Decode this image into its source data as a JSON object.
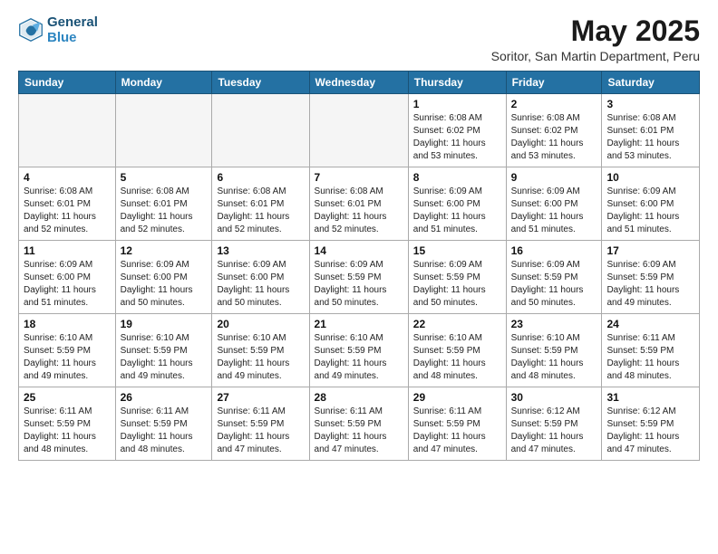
{
  "logo": {
    "line1": "General",
    "line2": "Blue"
  },
  "title": "May 2025",
  "subtitle": "Soritor, San Martin Department, Peru",
  "days_of_week": [
    "Sunday",
    "Monday",
    "Tuesday",
    "Wednesday",
    "Thursday",
    "Friday",
    "Saturday"
  ],
  "weeks": [
    [
      {
        "day": "",
        "info": ""
      },
      {
        "day": "",
        "info": ""
      },
      {
        "day": "",
        "info": ""
      },
      {
        "day": "",
        "info": ""
      },
      {
        "day": "1",
        "info": "Sunrise: 6:08 AM\nSunset: 6:02 PM\nDaylight: 11 hours\nand 53 minutes."
      },
      {
        "day": "2",
        "info": "Sunrise: 6:08 AM\nSunset: 6:02 PM\nDaylight: 11 hours\nand 53 minutes."
      },
      {
        "day": "3",
        "info": "Sunrise: 6:08 AM\nSunset: 6:01 PM\nDaylight: 11 hours\nand 53 minutes."
      }
    ],
    [
      {
        "day": "4",
        "info": "Sunrise: 6:08 AM\nSunset: 6:01 PM\nDaylight: 11 hours\nand 52 minutes."
      },
      {
        "day": "5",
        "info": "Sunrise: 6:08 AM\nSunset: 6:01 PM\nDaylight: 11 hours\nand 52 minutes."
      },
      {
        "day": "6",
        "info": "Sunrise: 6:08 AM\nSunset: 6:01 PM\nDaylight: 11 hours\nand 52 minutes."
      },
      {
        "day": "7",
        "info": "Sunrise: 6:08 AM\nSunset: 6:01 PM\nDaylight: 11 hours\nand 52 minutes."
      },
      {
        "day": "8",
        "info": "Sunrise: 6:09 AM\nSunset: 6:00 PM\nDaylight: 11 hours\nand 51 minutes."
      },
      {
        "day": "9",
        "info": "Sunrise: 6:09 AM\nSunset: 6:00 PM\nDaylight: 11 hours\nand 51 minutes."
      },
      {
        "day": "10",
        "info": "Sunrise: 6:09 AM\nSunset: 6:00 PM\nDaylight: 11 hours\nand 51 minutes."
      }
    ],
    [
      {
        "day": "11",
        "info": "Sunrise: 6:09 AM\nSunset: 6:00 PM\nDaylight: 11 hours\nand 51 minutes."
      },
      {
        "day": "12",
        "info": "Sunrise: 6:09 AM\nSunset: 6:00 PM\nDaylight: 11 hours\nand 50 minutes."
      },
      {
        "day": "13",
        "info": "Sunrise: 6:09 AM\nSunset: 6:00 PM\nDaylight: 11 hours\nand 50 minutes."
      },
      {
        "day": "14",
        "info": "Sunrise: 6:09 AM\nSunset: 5:59 PM\nDaylight: 11 hours\nand 50 minutes."
      },
      {
        "day": "15",
        "info": "Sunrise: 6:09 AM\nSunset: 5:59 PM\nDaylight: 11 hours\nand 50 minutes."
      },
      {
        "day": "16",
        "info": "Sunrise: 6:09 AM\nSunset: 5:59 PM\nDaylight: 11 hours\nand 50 minutes."
      },
      {
        "day": "17",
        "info": "Sunrise: 6:09 AM\nSunset: 5:59 PM\nDaylight: 11 hours\nand 49 minutes."
      }
    ],
    [
      {
        "day": "18",
        "info": "Sunrise: 6:10 AM\nSunset: 5:59 PM\nDaylight: 11 hours\nand 49 minutes."
      },
      {
        "day": "19",
        "info": "Sunrise: 6:10 AM\nSunset: 5:59 PM\nDaylight: 11 hours\nand 49 minutes."
      },
      {
        "day": "20",
        "info": "Sunrise: 6:10 AM\nSunset: 5:59 PM\nDaylight: 11 hours\nand 49 minutes."
      },
      {
        "day": "21",
        "info": "Sunrise: 6:10 AM\nSunset: 5:59 PM\nDaylight: 11 hours\nand 49 minutes."
      },
      {
        "day": "22",
        "info": "Sunrise: 6:10 AM\nSunset: 5:59 PM\nDaylight: 11 hours\nand 48 minutes."
      },
      {
        "day": "23",
        "info": "Sunrise: 6:10 AM\nSunset: 5:59 PM\nDaylight: 11 hours\nand 48 minutes."
      },
      {
        "day": "24",
        "info": "Sunrise: 6:11 AM\nSunset: 5:59 PM\nDaylight: 11 hours\nand 48 minutes."
      }
    ],
    [
      {
        "day": "25",
        "info": "Sunrise: 6:11 AM\nSunset: 5:59 PM\nDaylight: 11 hours\nand 48 minutes."
      },
      {
        "day": "26",
        "info": "Sunrise: 6:11 AM\nSunset: 5:59 PM\nDaylight: 11 hours\nand 48 minutes."
      },
      {
        "day": "27",
        "info": "Sunrise: 6:11 AM\nSunset: 5:59 PM\nDaylight: 11 hours\nand 47 minutes."
      },
      {
        "day": "28",
        "info": "Sunrise: 6:11 AM\nSunset: 5:59 PM\nDaylight: 11 hours\nand 47 minutes."
      },
      {
        "day": "29",
        "info": "Sunrise: 6:11 AM\nSunset: 5:59 PM\nDaylight: 11 hours\nand 47 minutes."
      },
      {
        "day": "30",
        "info": "Sunrise: 6:12 AM\nSunset: 5:59 PM\nDaylight: 11 hours\nand 47 minutes."
      },
      {
        "day": "31",
        "info": "Sunrise: 6:12 AM\nSunset: 5:59 PM\nDaylight: 11 hours\nand 47 minutes."
      }
    ]
  ]
}
